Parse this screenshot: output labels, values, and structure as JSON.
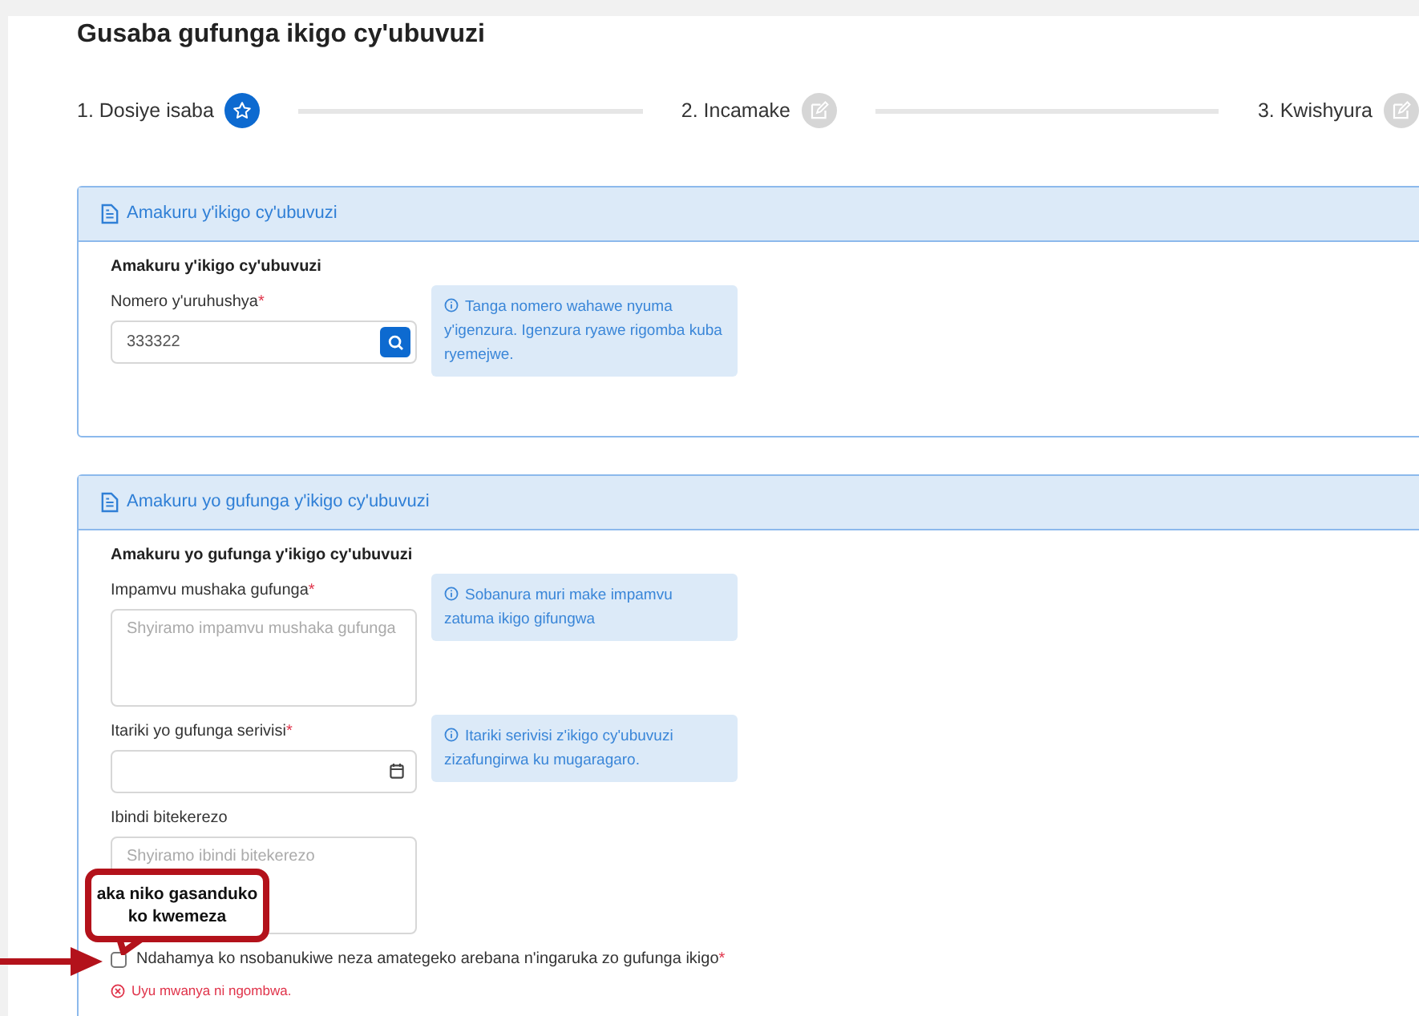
{
  "page_title": "Gusaba gufunga ikigo cy'ubuvuzi",
  "steps": [
    {
      "label": "1. Dosiye isaba",
      "selected": true
    },
    {
      "label": "2. Incamake",
      "selected": false
    },
    {
      "label": "3. Kwishyura",
      "selected": false
    }
  ],
  "sections": [
    {
      "header": "Amakuru y'ikigo cy'ubuvuzi",
      "subtitle": "Amakuru y'ikigo cy'ubuvuzi",
      "fields": [
        {
          "kind": "search",
          "label": "Nomero y'uruhushya",
          "required_mark": "*",
          "value": "333322",
          "hint": "Tanga nomero wahawe nyuma y'igenzura. Igenzura ryawe rigomba kuba ryemejwe."
        }
      ]
    },
    {
      "header": "Amakuru yo gufunga y'ikigo cy'ubuvuzi",
      "subtitle": "Amakuru yo gufunga y'ikigo cy'ubuvuzi",
      "fields": [
        {
          "kind": "textarea",
          "label": "Impamvu mushaka gufunga",
          "required_mark": "*",
          "placeholder": "Shyiramo impamvu mushaka gufunga",
          "hint": "Sobanura muri make impamvu zatuma ikigo gifungwa"
        },
        {
          "kind": "date",
          "label": "Itariki yo gufunga serivisi",
          "required_mark": "*",
          "hint": "Itariki serivisi z'ikigo cy'ubuvuzi zizafungirwa ku mugaragaro."
        },
        {
          "kind": "textarea",
          "label": "Ibindi bitekerezo",
          "placeholder": "Shyiramo ibindi bitekerezo"
        }
      ],
      "agreement": {
        "label": "Ndahamya ko nsobanukiwe neza amategeko arebana n'ingaruka zo gufunga ikigo",
        "required_mark": "*",
        "checked": false,
        "error": "Uyu mwanya ni ngombwa."
      }
    }
  ],
  "annotation": {
    "text": "aka niko gasanduko ko kwemeza"
  }
}
